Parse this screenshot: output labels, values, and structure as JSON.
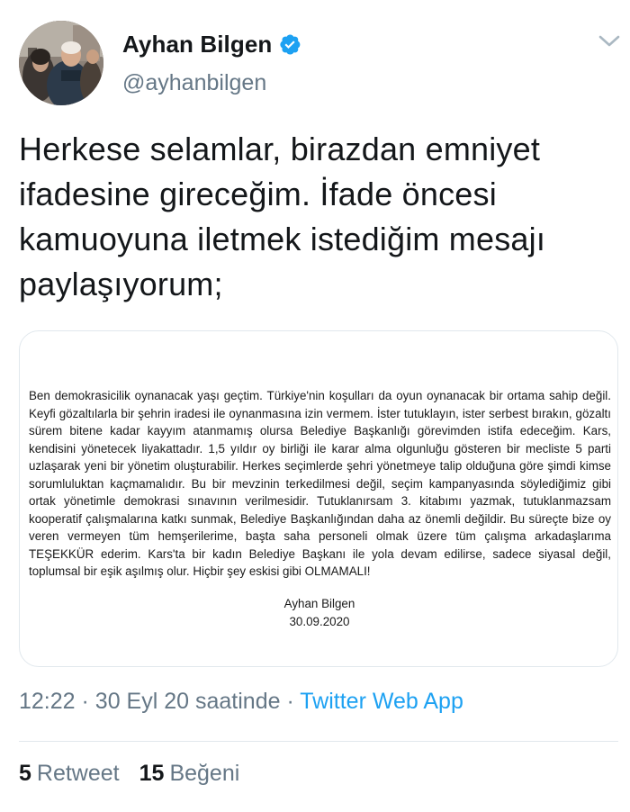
{
  "tweet": {
    "author": {
      "display_name": "Ayhan Bilgen",
      "handle": "@ayhanbilgen",
      "verified": true,
      "verified_icon": "verified-badge-icon",
      "avatar_icon": "profile-photo"
    },
    "menu_icon": "chevron-down-icon",
    "text": "Herkese selamlar, birazdan emniyet ifadesine gireceğim. İfade öncesi kamuoyuna iletmek istediğim mesajı paylaşıyorum;",
    "attached_image": {
      "body": "Ben demokrasicilik oynanacak yaşı geçtim. Türkiye'nin koşulları da oyun oynanacak bir ortama sahip değil. Keyfi gözaltılarla bir şehrin iradesi ile oynanmasına izin vermem. İster tutuklayın, ister serbest bırakın, gözaltı sürem bitene kadar kayyım atanmamış olursa Belediye Başkanlığı görevimden istifa edeceğim. Kars, kendisini yönetecek liyakattadır. 1,5 yıldır oy birliği ile karar alma olgunluğu gösteren bir mecliste 5 parti uzlaşarak yeni bir yönetim oluşturabilir. Herkes seçimlerde şehri yönetmeye talip olduğuna göre şimdi kimse sorumluluktan kaçmamalıdır. Bu bir mevzinin terkedilmesi değil, seçim kampanyasında söylediğimiz gibi ortak yönetimle demokrasi sınavının verilmesidir. Tutuklanırsam 3. kitabımı yazmak, tutuklanmazsam kooperatif çalışmalarına katkı sunmak, Belediye Başkanlığından daha az önemli değildir. Bu süreçte bize oy veren vermeyen tüm hemşerilerime, başta saha personeli olmak üzere tüm çalışma arkadaşlarıma TEŞEKKÜR ederim. Kars'ta bir kadın Belediye Başkanı ile yola devam edilirse, sadece siyasal değil, toplumsal bir eşik aşılmış olur. Hiçbir şey eskisi gibi OLMAMALI!",
      "signature_name": "Ayhan Bilgen",
      "signature_date": "30.09.2020"
    },
    "meta": {
      "time": "12:22",
      "separator": "·",
      "date": "30 Eyl 20 saatinde",
      "source": "Twitter Web App"
    },
    "stats": {
      "retweet_count": "5",
      "retweet_label": "Retweet",
      "like_count": "15",
      "like_label": "Beğeni"
    }
  },
  "colors": {
    "text_primary": "#14171a",
    "text_secondary": "#657786",
    "accent": "#1da1f2",
    "border": "#e1e8ed"
  }
}
